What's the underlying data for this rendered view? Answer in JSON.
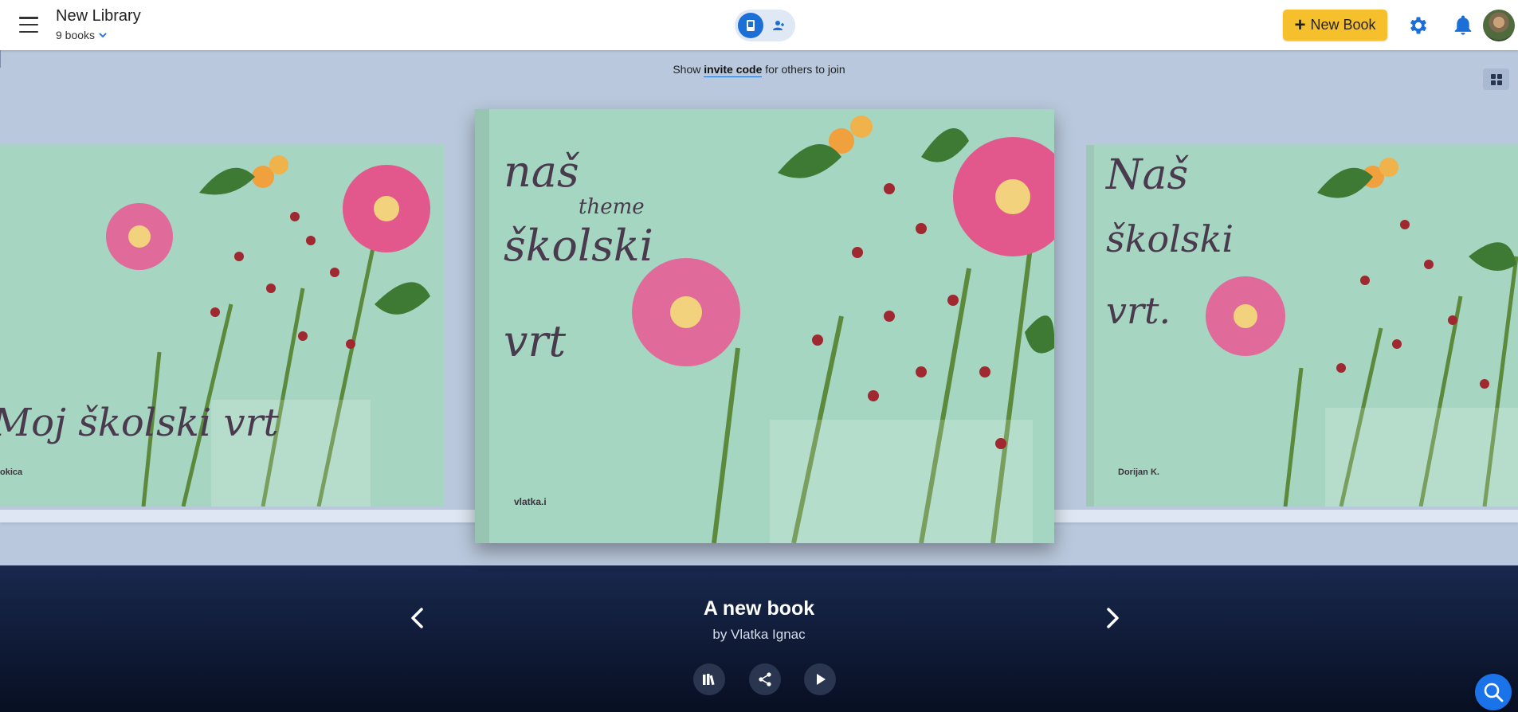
{
  "header": {
    "library_title": "New Library",
    "book_count": "9 books",
    "new_book_label": "New Book"
  },
  "invite": {
    "prefix": "Show",
    "link": "invite code",
    "suffix": "for others to join"
  },
  "books": {
    "left": {
      "title": "Moj školski vrt",
      "author": "okica"
    },
    "center": {
      "title_line1": "naš",
      "title_line2": "theme",
      "title_line3": "školski",
      "title_line4": "vrt",
      "author": "vlatka.i"
    },
    "right": {
      "title_line1": "Naš",
      "title_line2": "školski",
      "title_line3": "vrt.",
      "author": "Dorijan K."
    }
  },
  "selected": {
    "title": "A new book",
    "author": "by Vlatka Ignac"
  },
  "icons": [
    "menu-icon",
    "chevron-down-icon",
    "book-icon",
    "people-icon",
    "plus-icon",
    "gear-icon",
    "bell-icon",
    "grid-icon",
    "chevron-left-icon",
    "chevron-right-icon",
    "library-icon",
    "share-icon",
    "play-icon",
    "search-icon"
  ],
  "colors": {
    "accent": "#1d6fd8",
    "new_book": "#f6c02d",
    "background": "#b9c8dc",
    "info_bar": "#0f1a36"
  }
}
